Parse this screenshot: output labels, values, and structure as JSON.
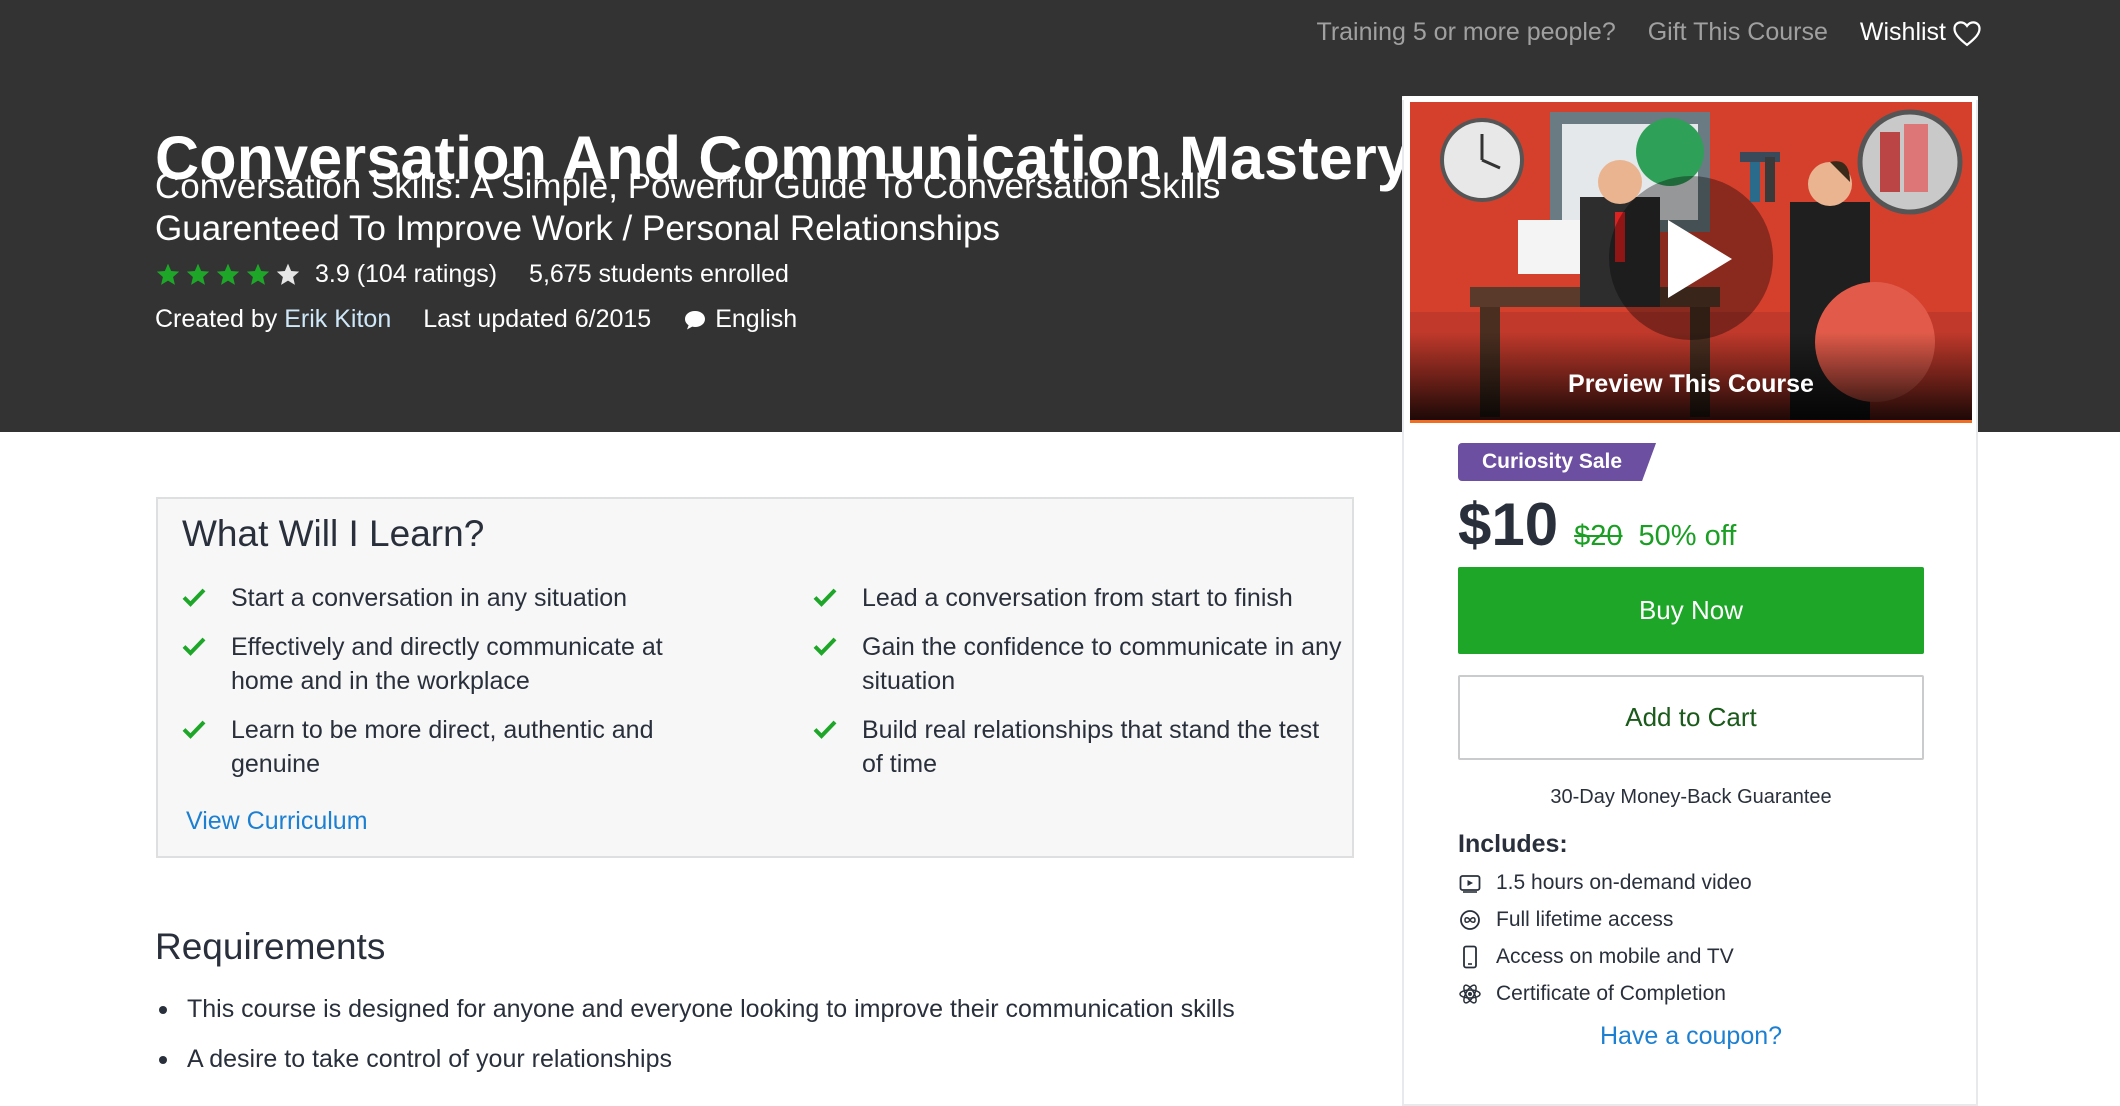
{
  "header": {
    "nav": {
      "training_label": "Training 5 or more people?",
      "gift_label": "Gift This Course",
      "wishlist_label": "Wishlist"
    },
    "title": "Conversation And Communication Mastery",
    "subtitle": "Conversation Skills: A Simple, Powerful Guide To Conversation Skills Guarenteed To Improve Work / Personal Relationships",
    "rating": {
      "stars_filled": 4,
      "stars_total": 5,
      "text": "3.9 (104 ratings)"
    },
    "enrolled": "5,675 students enrolled",
    "created_by_label": "Created by",
    "author": "Erik Kiton",
    "last_updated": "Last updated 6/2015",
    "language": "English",
    "colors": {
      "hero_bg": "#333333",
      "star": "#1ea629"
    }
  },
  "sidebar": {
    "preview_label": "Preview This Course",
    "badge": "Curiosity Sale",
    "price_current": "$10",
    "price_original": "$20",
    "discount": "50% off",
    "buy_label": "Buy Now",
    "cart_label": "Add to Cart",
    "guarantee": "30-Day Money-Back Guarantee",
    "includes_heading": "Includes:",
    "includes": [
      {
        "icon": "video-icon",
        "text": "1.5 hours on-demand video"
      },
      {
        "icon": "infinity-icon",
        "text": "Full lifetime access"
      },
      {
        "icon": "mobile-icon",
        "text": "Access on mobile and TV"
      },
      {
        "icon": "certificate-icon",
        "text": "Certificate of Completion"
      }
    ],
    "coupon_label": "Have a coupon?",
    "colors": {
      "buy": "#1ea629",
      "badge": "#6c4fa1",
      "discount": "#1a9e24"
    }
  },
  "learn": {
    "heading": "What Will I Learn?",
    "left": [
      "Start a conversation in any situation",
      "Effectively and directly communicate at home and in the workplace",
      "Learn to be more direct, authentic and genuine"
    ],
    "right": [
      "Lead a conversation from start to finish",
      "Gain the confidence to communicate in any situation",
      "Build real relationships that stand the test of time"
    ],
    "view_curriculum": "View Curriculum"
  },
  "requirements": {
    "heading": "Requirements",
    "items": [
      "This course is designed for anyone and everyone looking to improve their communication skills",
      "A desire to take control of your relationships"
    ]
  }
}
